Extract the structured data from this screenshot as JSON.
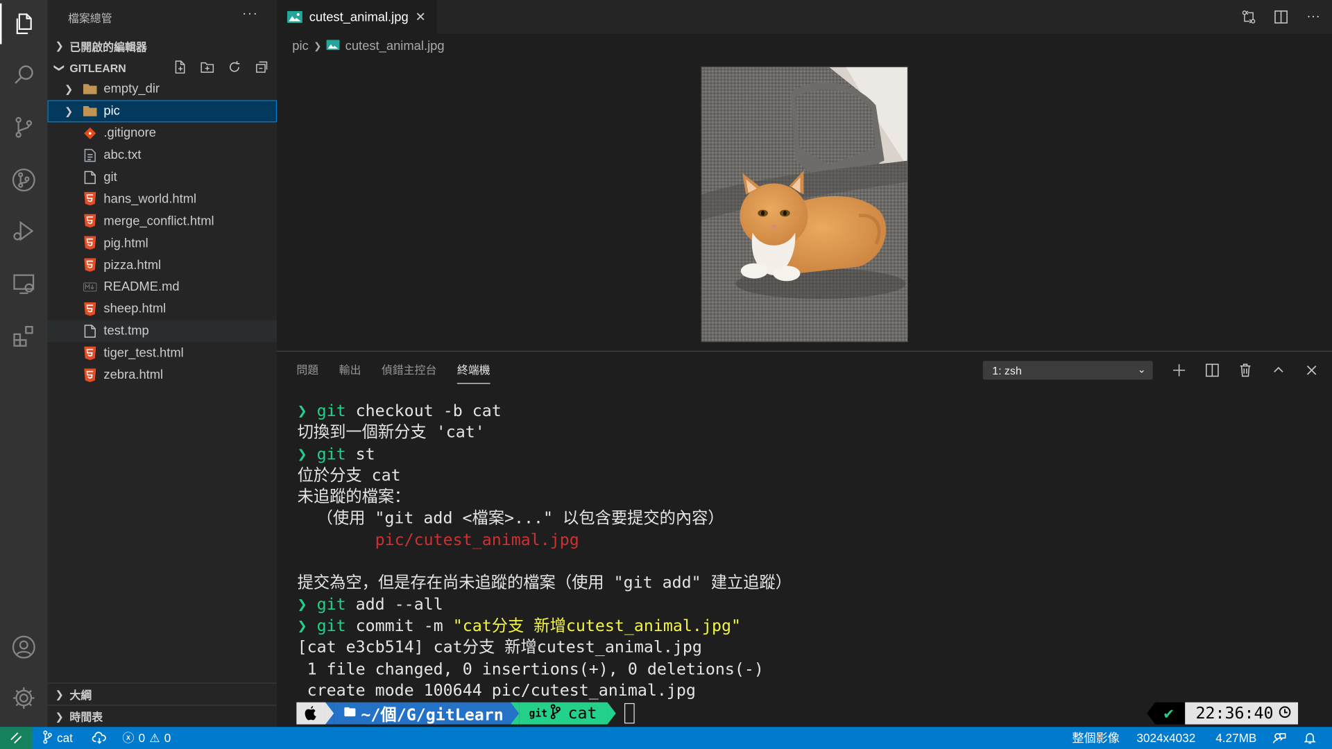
{
  "sidebar": {
    "title": "檔案總管",
    "open_editors": "已開啟的編輯器",
    "project": "GITLEARN",
    "outline": "大綱",
    "timeline": "時間表",
    "items": [
      {
        "label": "empty_dir",
        "kind": "folder"
      },
      {
        "label": "pic",
        "kind": "folder"
      },
      {
        "label": ".gitignore",
        "kind": "git"
      },
      {
        "label": "abc.txt",
        "kind": "txt"
      },
      {
        "label": "git",
        "kind": "file"
      },
      {
        "label": "hans_world.html",
        "kind": "html"
      },
      {
        "label": "merge_conflict.html",
        "kind": "html"
      },
      {
        "label": "pig.html",
        "kind": "html"
      },
      {
        "label": "pizza.html",
        "kind": "html"
      },
      {
        "label": "README.md",
        "kind": "md"
      },
      {
        "label": "sheep.html",
        "kind": "html"
      },
      {
        "label": "test.tmp",
        "kind": "file"
      },
      {
        "label": "tiger_test.html",
        "kind": "html"
      },
      {
        "label": "zebra.html",
        "kind": "html"
      }
    ]
  },
  "editor": {
    "tab_label": "cutest_animal.jpg",
    "breadcrumb_folder": "pic",
    "breadcrumb_file": "cutest_animal.jpg"
  },
  "panel": {
    "tabs": [
      "問題",
      "輸出",
      "偵錯主控台",
      "終端機"
    ],
    "terminal_select": "1: zsh"
  },
  "terminal": {
    "lines": [
      {
        "parts": [
          {
            "t": "❯ ",
            "c": "pr"
          },
          {
            "t": "git",
            "c": "g"
          },
          {
            "t": " checkout -b cat",
            "c": ""
          }
        ]
      },
      {
        "parts": [
          {
            "t": "切換到一個新分支 'cat'",
            "c": ""
          }
        ]
      },
      {
        "parts": [
          {
            "t": "❯ ",
            "c": "pr"
          },
          {
            "t": "git",
            "c": "g"
          },
          {
            "t": " st",
            "c": ""
          }
        ]
      },
      {
        "parts": [
          {
            "t": "位於分支 cat",
            "c": ""
          }
        ]
      },
      {
        "parts": [
          {
            "t": "未追蹤的檔案：",
            "c": ""
          }
        ]
      },
      {
        "parts": [
          {
            "t": "  （使用 \"git add <檔案>...\" 以包含要提交的內容）",
            "c": ""
          }
        ]
      },
      {
        "parts": [
          {
            "t": "        pic/cutest_animal.jpg",
            "c": "r"
          }
        ]
      },
      {
        "parts": [
          {
            "t": "",
            "c": ""
          }
        ]
      },
      {
        "parts": [
          {
            "t": "提交為空，但是存在尚未追蹤的檔案（使用 \"git add\" 建立追蹤）",
            "c": ""
          }
        ]
      },
      {
        "parts": [
          {
            "t": "❯ ",
            "c": "pr"
          },
          {
            "t": "git",
            "c": "g"
          },
          {
            "t": " add --all",
            "c": ""
          }
        ]
      },
      {
        "parts": [
          {
            "t": "❯ ",
            "c": "pr"
          },
          {
            "t": "git",
            "c": "g"
          },
          {
            "t": " commit -m ",
            "c": ""
          },
          {
            "t": "\"cat分支 新增cutest_animal.jpg\"",
            "c": "y"
          }
        ]
      },
      {
        "parts": [
          {
            "t": "[cat e3cb514] cat分支 新增cutest_animal.jpg",
            "c": ""
          }
        ]
      },
      {
        "parts": [
          {
            "t": " 1 file changed, 0 insertions(+), 0 deletions(-)",
            "c": ""
          }
        ]
      },
      {
        "parts": [
          {
            "t": " create mode 100644 pic/cutest_animal.jpg",
            "c": ""
          }
        ]
      }
    ],
    "prompt_path": "~/個/G/gitLearn",
    "prompt_git_label": "git",
    "prompt_branch": "cat",
    "check": "✔",
    "clock": "22:36:40"
  },
  "status": {
    "branch": "cat",
    "errors": "0",
    "warnings": "0",
    "zoom": "整個影像",
    "dimensions": "3024x4032",
    "size": "4.27MB"
  },
  "colors": {
    "accent": "#007acc",
    "remote": "#16825d",
    "selection": "#04395e"
  }
}
